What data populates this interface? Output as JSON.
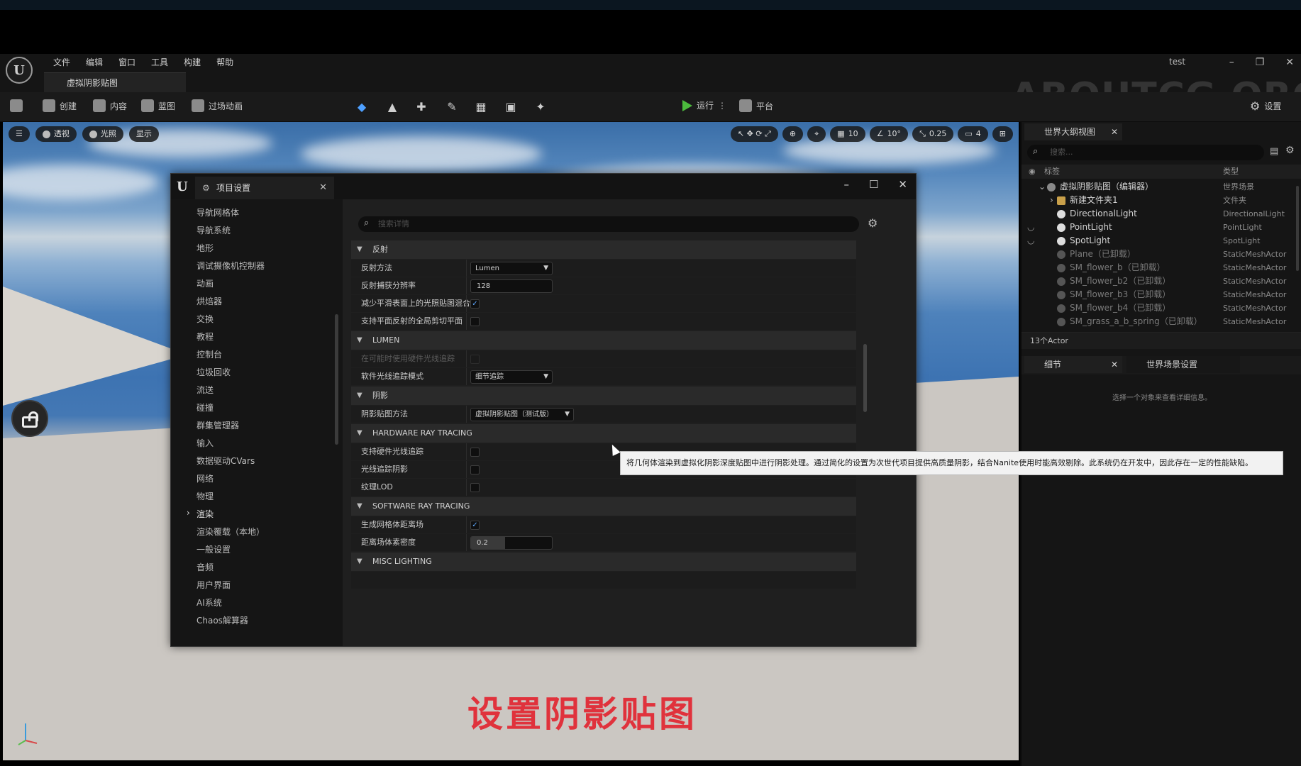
{
  "menubar": [
    "文件",
    "编辑",
    "窗口",
    "工具",
    "构建",
    "帮助"
  ],
  "level_tab": "虚拟阴影贴图",
  "project_name": "test",
  "watermark": "ABOUTCG.ORG",
  "toolbar": {
    "create": "创建",
    "content": "内容",
    "blueprint": "蓝图",
    "cinematics": "过场动画",
    "play": "运行",
    "platform": "平台",
    "settings": "设置"
  },
  "viewport": {
    "perspective": "透视",
    "lit": "光照",
    "show": "显示",
    "grid_snap": "10",
    "rot_snap": "10°",
    "scale_snap": "0.25",
    "camera_speed": "4",
    "caption": "设置阴影贴图"
  },
  "outliner": {
    "tab": "世界大纲视图",
    "search_placeholder": "搜索...",
    "col_label": "标签",
    "col_type": "类型",
    "rows": [
      {
        "name": "虚拟阴影贴图（编辑器）",
        "type": "世界场景"
      },
      {
        "name": "新建文件夹1",
        "type": "文件夹"
      },
      {
        "name": "DirectionalLight",
        "type": "DirectionalLight"
      },
      {
        "name": "PointLight",
        "type": "PointLight"
      },
      {
        "name": "SpotLight",
        "type": "SpotLight"
      },
      {
        "name": "Plane（已卸载）",
        "type": "StaticMeshActor"
      },
      {
        "name": "SM_flower_b（已卸载）",
        "type": "StaticMeshActor"
      },
      {
        "name": "SM_flower_b2（已卸载）",
        "type": "StaticMeshActor"
      },
      {
        "name": "SM_flower_b3（已卸载）",
        "type": "StaticMeshActor"
      },
      {
        "name": "SM_flower_b4（已卸载）",
        "type": "StaticMeshActor"
      },
      {
        "name": "SM_grass_a_b_spring（已卸载）",
        "type": "StaticMeshActor"
      }
    ],
    "actor_count": "13个Actor"
  },
  "details": {
    "tab": "细节",
    "world_settings_tab": "世界场景设置",
    "empty_text": "选择一个对象来查看详细信息。"
  },
  "dialog": {
    "title": "项目设置",
    "search_placeholder": "搜索详情",
    "nav": [
      "导航网格体",
      "导航系统",
      "地形",
      "调试摄像机控制器",
      "动画",
      "烘焙器",
      "交换",
      "教程",
      "控制台",
      "垃圾回收",
      "流送",
      "碰撞",
      "群集管理器",
      "输入",
      "数据驱动CVars",
      "网络",
      "物理",
      "渲染",
      "渲染覆载（本地）",
      "一般设置",
      "音频",
      "用户界面",
      "AI系统",
      "Chaos解算器"
    ],
    "sections": {
      "reflections": "反射",
      "reflection_method": "反射方法",
      "reflection_method_value": "Lumen",
      "reflection_capture_res": "反射捕获分辨率",
      "reflection_capture_res_value": "128",
      "reduce_lightmap_mixing": "减少平滑表面上的光照贴图混合",
      "global_clip_plane": "支持平面反射的全局剪切平面",
      "lumen": "LUMEN",
      "hw_rt_when_available": "在可能时使用硬件光线追踪",
      "sw_rt_mode": "软件光线追踪模式",
      "sw_rt_mode_value": "细节追踪",
      "shadows": "阴影",
      "shadow_map_method": "阴影贴图方法",
      "shadow_map_method_value": "虚拟阴影贴图（测试版）",
      "hw_rt": "HARDWARE RAY TRACING",
      "support_hw_rt": "支持硬件光线追踪",
      "rt_shadows": "光线追踪阴影",
      "texture_lod": "纹理LOD",
      "sw_rt": "SOFTWARE RAY TRACING",
      "gen_mesh_df": "生成网格体距离场",
      "df_voxel_density": "距离场体素密度",
      "df_voxel_density_value": "0.2",
      "misc_lighting": "MISC LIGHTING"
    },
    "tooltip": "将几何体渲染到虚拟化阴影深度贴图中进行阴影处理。通过简化的设置为次世代项目提供高质量阴影，结合Nanite使用时能高效剔除。此系统仍在开发中，因此存在一定的性能缺陷。"
  },
  "colors": {
    "accent_blue": "#5ea8ff",
    "play_green": "#4cbb3d",
    "caption_red": "#e0323c"
  }
}
